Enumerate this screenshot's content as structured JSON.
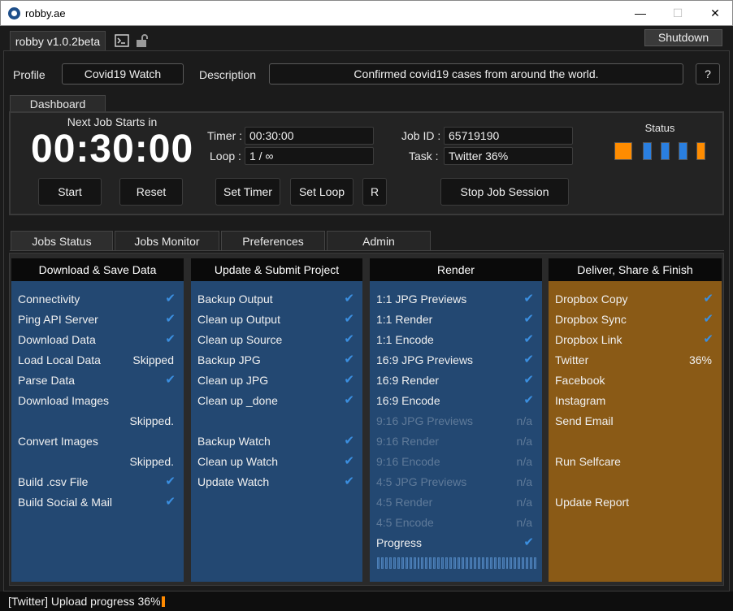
{
  "window": {
    "title": "robby.ae",
    "minimize": "—",
    "maximize": "☐",
    "close": "✕"
  },
  "header": {
    "version": "robby v1.0.2beta",
    "shutdown_label": "Shutdown"
  },
  "profile": {
    "label": "Profile",
    "value": "Covid19 Watch",
    "description_label": "Description",
    "description": "Confirmed covid19 cases from around the world.",
    "help_label": "?"
  },
  "dashboard": {
    "tab_label": "Dashboard",
    "next_job_label": "Next Job Starts in",
    "countdown": "00:30:00",
    "timer_label": "Timer :",
    "timer_value": "00:30:00",
    "loop_label": "Loop :",
    "loop_value": "1 / ∞",
    "job_id_label": "Job ID :",
    "job_id_value": "65719190",
    "task_label": "Task :",
    "task_value": "Twitter 36%",
    "buttons": {
      "start": "Start",
      "reset": "Reset",
      "set_timer": "Set Timer",
      "set_loop": "Set Loop",
      "r": "R",
      "stop_session": "Stop Job Session"
    },
    "status_label": "Status",
    "status_colors": {
      "orange": "#ff8c00",
      "blue": "#2a7fe0"
    }
  },
  "tabs": [
    "Jobs Status",
    "Jobs Monitor",
    "Preferences",
    "Admin"
  ],
  "columns": {
    "download": {
      "title": "Download & Save Data",
      "rows": [
        {
          "label": "Connectivity",
          "status": "✔"
        },
        {
          "label": "Ping API Server",
          "status": "✔"
        },
        {
          "label": "Download Data",
          "status": "✔"
        },
        {
          "label": "Load Local Data",
          "value": "Skipped"
        },
        {
          "label": "Parse Data",
          "status": "✔"
        },
        {
          "label": "Download Images"
        },
        {
          "value": "Skipped."
        },
        {
          "label": "Convert Images"
        },
        {
          "value": "Skipped."
        },
        {
          "label": "Build .csv File",
          "status": "✔"
        },
        {
          "label": "Build Social & Mail",
          "status": "✔"
        }
      ]
    },
    "update": {
      "title": "Update & Submit Project",
      "rows": [
        {
          "label": "Backup Output",
          "status": "✔"
        },
        {
          "label": "Clean up Output",
          "status": "✔"
        },
        {
          "label": "Clean up Source",
          "status": "✔"
        },
        {
          "label": "Backup JPG",
          "status": "✔"
        },
        {
          "label": "Clean up JPG",
          "status": "✔"
        },
        {
          "label": "Clean up _done",
          "status": "✔"
        },
        {
          "label": "Backup Watch",
          "status": "✔"
        },
        {
          "label": "Clean up Watch",
          "status": "✔"
        },
        {
          "label": "Update Watch",
          "status": "✔"
        }
      ]
    },
    "render": {
      "title": "Render",
      "rows": [
        {
          "label": "1:1 JPG Previews",
          "status": "✔"
        },
        {
          "label": "1:1 Render",
          "status": "✔"
        },
        {
          "label": "1:1 Encode",
          "status": "✔"
        },
        {
          "label": "16:9 JPG Previews",
          "status": "✔"
        },
        {
          "label": "16:9 Render",
          "status": "✔"
        },
        {
          "label": "16:9 Encode",
          "status": "✔"
        },
        {
          "label": "9:16 JPG Previews",
          "value": "n/a"
        },
        {
          "label": "9:16 Render",
          "value": "n/a"
        },
        {
          "label": "9:16 Encode",
          "value": "n/a"
        },
        {
          "label": "4:5 JPG Previews",
          "value": "n/a"
        },
        {
          "label": "4:5 Render",
          "value": "n/a"
        },
        {
          "label": "4:5 Encode",
          "value": "n/a"
        },
        {
          "label": "Progress",
          "status": "✔"
        }
      ],
      "progress_fraction": 1.0
    },
    "deliver": {
      "title": "Deliver, Share & Finish",
      "rows": [
        {
          "label": "Dropbox Copy",
          "status": "✔"
        },
        {
          "label": "Dropbox Sync",
          "status": "✔"
        },
        {
          "label": "Dropbox Link",
          "status": "✔"
        },
        {
          "label": "Twitter",
          "value": "36%"
        },
        {
          "label": "Facebook"
        },
        {
          "label": "Instagram"
        },
        {
          "label": "Send Email"
        },
        {
          "label": "Run Selfcare"
        },
        {
          "label": "Update Report"
        }
      ]
    }
  },
  "statusbar": {
    "message": "[Twitter] Upload progress 36%"
  }
}
